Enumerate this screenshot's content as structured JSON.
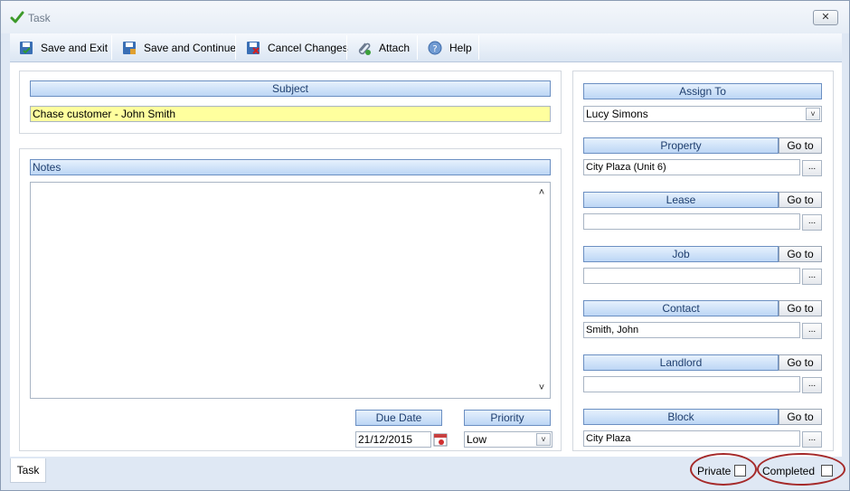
{
  "window": {
    "title": "Task",
    "close_label": "✕"
  },
  "toolbar": {
    "save_exit": "Save and Exit",
    "save_continue": "Save and Continue",
    "cancel_changes": "Cancel Changes",
    "attach": "Attach",
    "help": "Help"
  },
  "subject": {
    "label": "Subject",
    "value": "Chase customer - John Smith"
  },
  "notes": {
    "label": "Notes",
    "value": ""
  },
  "due_date": {
    "label": "Due Date",
    "value": "21/12/2015"
  },
  "priority": {
    "label": "Priority",
    "value": "Low"
  },
  "assign_to": {
    "label": "Assign To",
    "value": "Lucy Simons"
  },
  "links": {
    "goto_label": "Go to",
    "dots_label": "...",
    "property": {
      "label": "Property",
      "value": "City Plaza (Unit 6)"
    },
    "lease": {
      "label": "Lease",
      "value": ""
    },
    "job": {
      "label": "Job",
      "value": ""
    },
    "contact": {
      "label": "Contact",
      "value": "Smith, John"
    },
    "landlord": {
      "label": "Landlord",
      "value": ""
    },
    "block": {
      "label": "Block",
      "value": "City Plaza"
    }
  },
  "bottom": {
    "tab_label": "Task",
    "private_label": "Private",
    "private_checked": false,
    "completed_label": "Completed",
    "completed_checked": false
  },
  "colors": {
    "highlight_oval": "#a52a2a",
    "subject_bg": "#ffff9e",
    "header_text": "#1e3e6e"
  }
}
